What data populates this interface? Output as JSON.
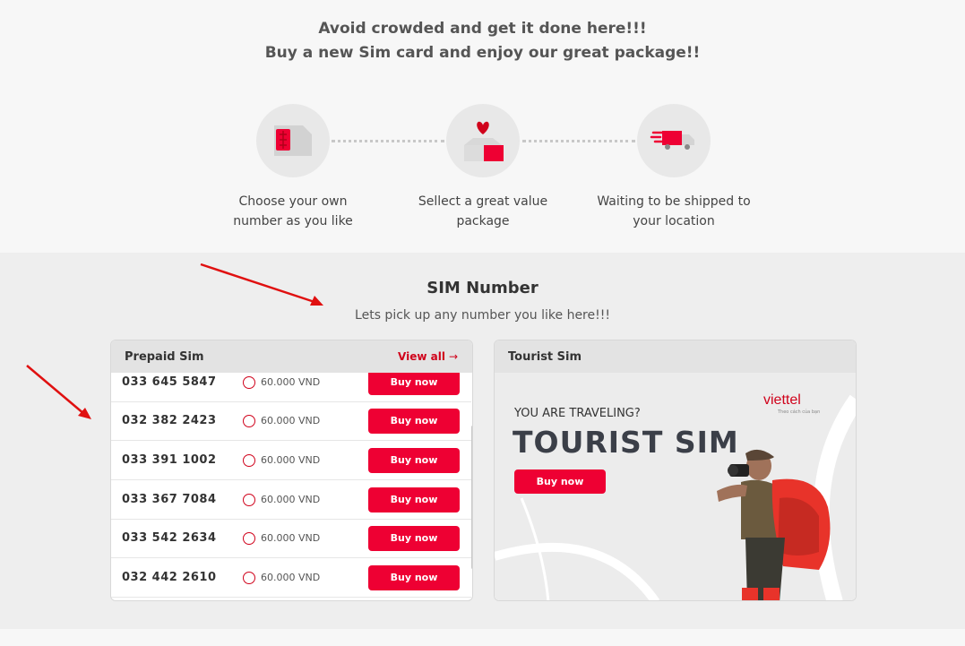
{
  "hero": {
    "line1": "Avoid crowded and get it done here!!!",
    "line2": "Buy a new Sim card and enjoy our great package!!"
  },
  "steps": [
    {
      "icon": "sim-card-icon",
      "caption_line1": "Choose your own",
      "caption_line2": "number as you like"
    },
    {
      "icon": "gift-box-icon",
      "caption_line1": "Sellect a great value",
      "caption_line2": "package"
    },
    {
      "icon": "delivery-truck-icon",
      "caption_line1": "Waiting to be shipped to",
      "caption_line2": "your location"
    }
  ],
  "section": {
    "title": "SIM Number",
    "subtitle": "Lets pick up any number you like here!!!"
  },
  "prepaid": {
    "title": "Prepaid Sim",
    "view_all": "View all",
    "rows": [
      {
        "number": "033 645 5847",
        "price": "60.000 VND",
        "button": "Buy now"
      },
      {
        "number": "032 382 2423",
        "price": "60.000 VND",
        "button": "Buy now"
      },
      {
        "number": "033 391 1002",
        "price": "60.000 VND",
        "button": "Buy now"
      },
      {
        "number": "033 367 7084",
        "price": "60.000 VND",
        "button": "Buy now"
      },
      {
        "number": "033 542 2634",
        "price": "60.000 VND",
        "button": "Buy now"
      },
      {
        "number": "032 442 2610",
        "price": "60.000 VND",
        "button": "Buy now"
      }
    ]
  },
  "tourist": {
    "title": "Tourist Sim",
    "logo": "viettel",
    "logo_sub": "Theo cách của bạn",
    "tagline": "YOU ARE TRAVELING?",
    "headline": "TOURIST SIM",
    "button": "Buy now"
  },
  "colors": {
    "accent": "#ee0033",
    "brand": "#d0021b"
  }
}
